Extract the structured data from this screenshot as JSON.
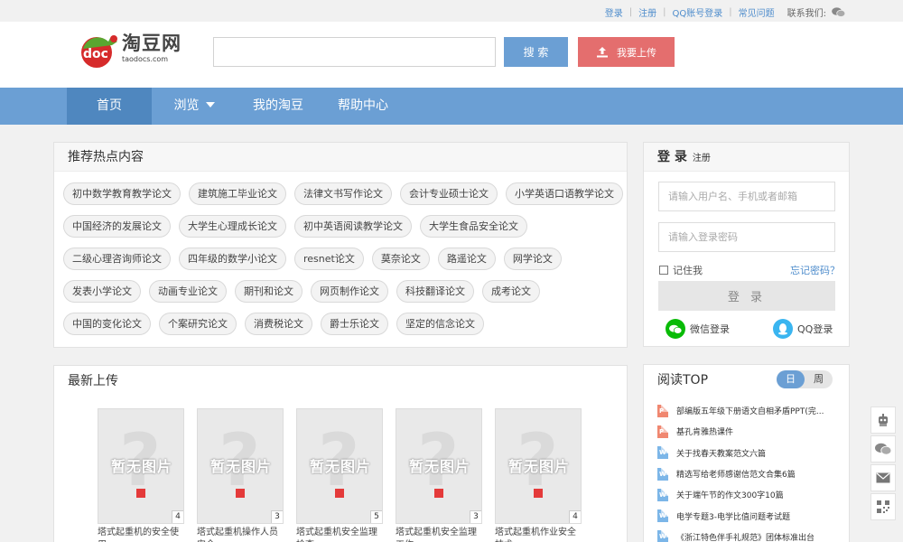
{
  "topbar": {
    "login": "登录",
    "register": "注册",
    "qq_login": "QQ账号登录",
    "faq": "常见问题",
    "contact": "联系我们:",
    "wechat_icon": "wechat-icon"
  },
  "logo": {
    "title": "淘豆网",
    "subtitle": "taodocs.com",
    "badge": "doc"
  },
  "search": {
    "placeholder": "",
    "button": "搜 索"
  },
  "upload": {
    "label": "我要上传",
    "icon": "upload-icon"
  },
  "nav": {
    "items": [
      {
        "label": "首页",
        "active": true
      },
      {
        "label": "浏览",
        "dropdown": true
      },
      {
        "label": "我的淘豆"
      },
      {
        "label": "帮助中心"
      }
    ]
  },
  "hot": {
    "title": "推荐热点内容",
    "rows": [
      [
        "初中数学教育教学论文",
        "建筑施工毕业论文",
        "法律文书写作论文",
        "会计专业硕士论文",
        "小学英语口语教学论文"
      ],
      [
        "中国经济的发展论文",
        "大学生心理成长论文",
        "初中英语阅读教学论文",
        "大学生食品安全论文"
      ],
      [
        "二级心理咨询师论文",
        "四年级的数学小论文",
        "resnet论文",
        "莫奈论文",
        "路遥论文",
        "网学论文"
      ],
      [
        "发表小学论文",
        "动画专业论文",
        "期刊和论文",
        "网页制作论文",
        "科技翻译论文",
        "成考论文"
      ],
      [
        "中国的变化论文",
        "个案研究论文",
        "消费税论文",
        "爵士乐论文",
        "坚定的信念论文"
      ]
    ]
  },
  "latest": {
    "title": "最新上传",
    "placeholder_text": "暂无图片",
    "docs": [
      {
        "title": "塔式起重机的安全使用",
        "pages": "4"
      },
      {
        "title": "塔式起重机操作人员安全",
        "pages": "3"
      },
      {
        "title": "塔式起重机安全监理检查",
        "pages": "5"
      },
      {
        "title": "塔式起重机安全监理工作",
        "pages": "3"
      },
      {
        "title": "塔式起重机作业安全技术",
        "pages": "4"
      }
    ]
  },
  "login": {
    "title": "登 录",
    "register": "注册",
    "username_placeholder": "请输入用户名、手机或者邮箱",
    "password_placeholder": "请输入登录密码",
    "remember": "记住我",
    "forgot": "忘记密码？",
    "submit": "登 录",
    "wechat": "微信登录",
    "qq": "QQ登录",
    "colors": {
      "wechat": "#09bb07",
      "qq": "#3ab5f0"
    }
  },
  "top_read": {
    "title": "阅读TOP",
    "tabs": [
      "日",
      "周"
    ],
    "items": [
      {
        "type": "ppt",
        "badge": "P",
        "title": "部编版五年级下册语文自相矛盾PPT(完..."
      },
      {
        "type": "ppt",
        "badge": "P",
        "title": "基孔肯雅热课件"
      },
      {
        "type": "doc",
        "badge": "W",
        "title": "关于找春天教案范文六篇"
      },
      {
        "type": "doc",
        "badge": "W",
        "title": "精选写给老师感谢信范文合集6篇"
      },
      {
        "type": "doc",
        "badge": "W",
        "title": "关于端午节的作文300字10篇"
      },
      {
        "type": "doc",
        "badge": "W",
        "title": "电学专题3-电学比值问题考试题"
      },
      {
        "type": "doc",
        "badge": "W",
        "title": "《浙江特色伴手礼规范》团体标准出台"
      }
    ]
  },
  "float_tools": [
    "robot-icon",
    "wechat-icon",
    "mail-icon",
    "qrcode-icon"
  ]
}
